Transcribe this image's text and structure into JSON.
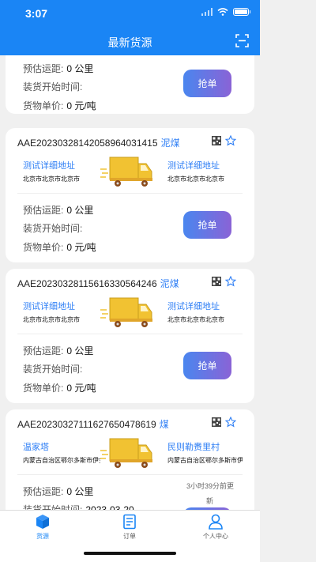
{
  "status_bar": {
    "time": "3:07"
  },
  "header": {
    "title": "最新货源"
  },
  "labels": {
    "distance": "预估运距:",
    "load_start": "装货开始时间:",
    "unit_price": "货物单价:",
    "grab": "抢单"
  },
  "partial_card": {
    "distance": "0 公里",
    "load_start": "",
    "unit_price": "0 元/吨"
  },
  "cards": [
    {
      "order_no": "AAE20230328142058964031415",
      "cargo": "泥煤",
      "from_title": "测试详细地址",
      "from_sub": "北京市北京市北京市",
      "to_title": "测试详细地址",
      "to_sub": "北京市北京市北京市",
      "distance": "0 公里",
      "load_start": "",
      "unit_price": "0 元/吨"
    },
    {
      "order_no": "AAE20230328115616330564246",
      "cargo": "泥煤",
      "from_title": "测试详细地址",
      "from_sub": "北京市北京市北京市",
      "to_title": "测试详细地址",
      "to_sub": "北京市北京市北京市",
      "distance": "0 公里",
      "load_start": "",
      "unit_price": "0 元/吨"
    },
    {
      "order_no": "AAE20230327111627650478619",
      "cargo": "煤",
      "from_title": "温家塔",
      "from_sub": "内蒙古自治区鄂尔多斯市伊金霍",
      "to_title": "民则勒赉里村",
      "to_sub": "内蒙古自治区鄂尔多斯市伊金霍",
      "distance": "0 公里",
      "load_start": "2023-03-20",
      "time_ago": "3小时39分前更",
      "tag": "新"
    }
  ],
  "tabbar": {
    "tabs": [
      {
        "label": "货源",
        "icon": "cube-icon",
        "active": true
      },
      {
        "label": "订单",
        "icon": "document-icon",
        "active": false
      },
      {
        "label": "个人中心",
        "icon": "person-icon",
        "active": false
      }
    ]
  },
  "colors": {
    "primary": "#1a85f5",
    "link": "#2f7ff5",
    "button_start": "#4a86ef",
    "button_end": "#8a63d6",
    "truck": "#f1c232"
  }
}
